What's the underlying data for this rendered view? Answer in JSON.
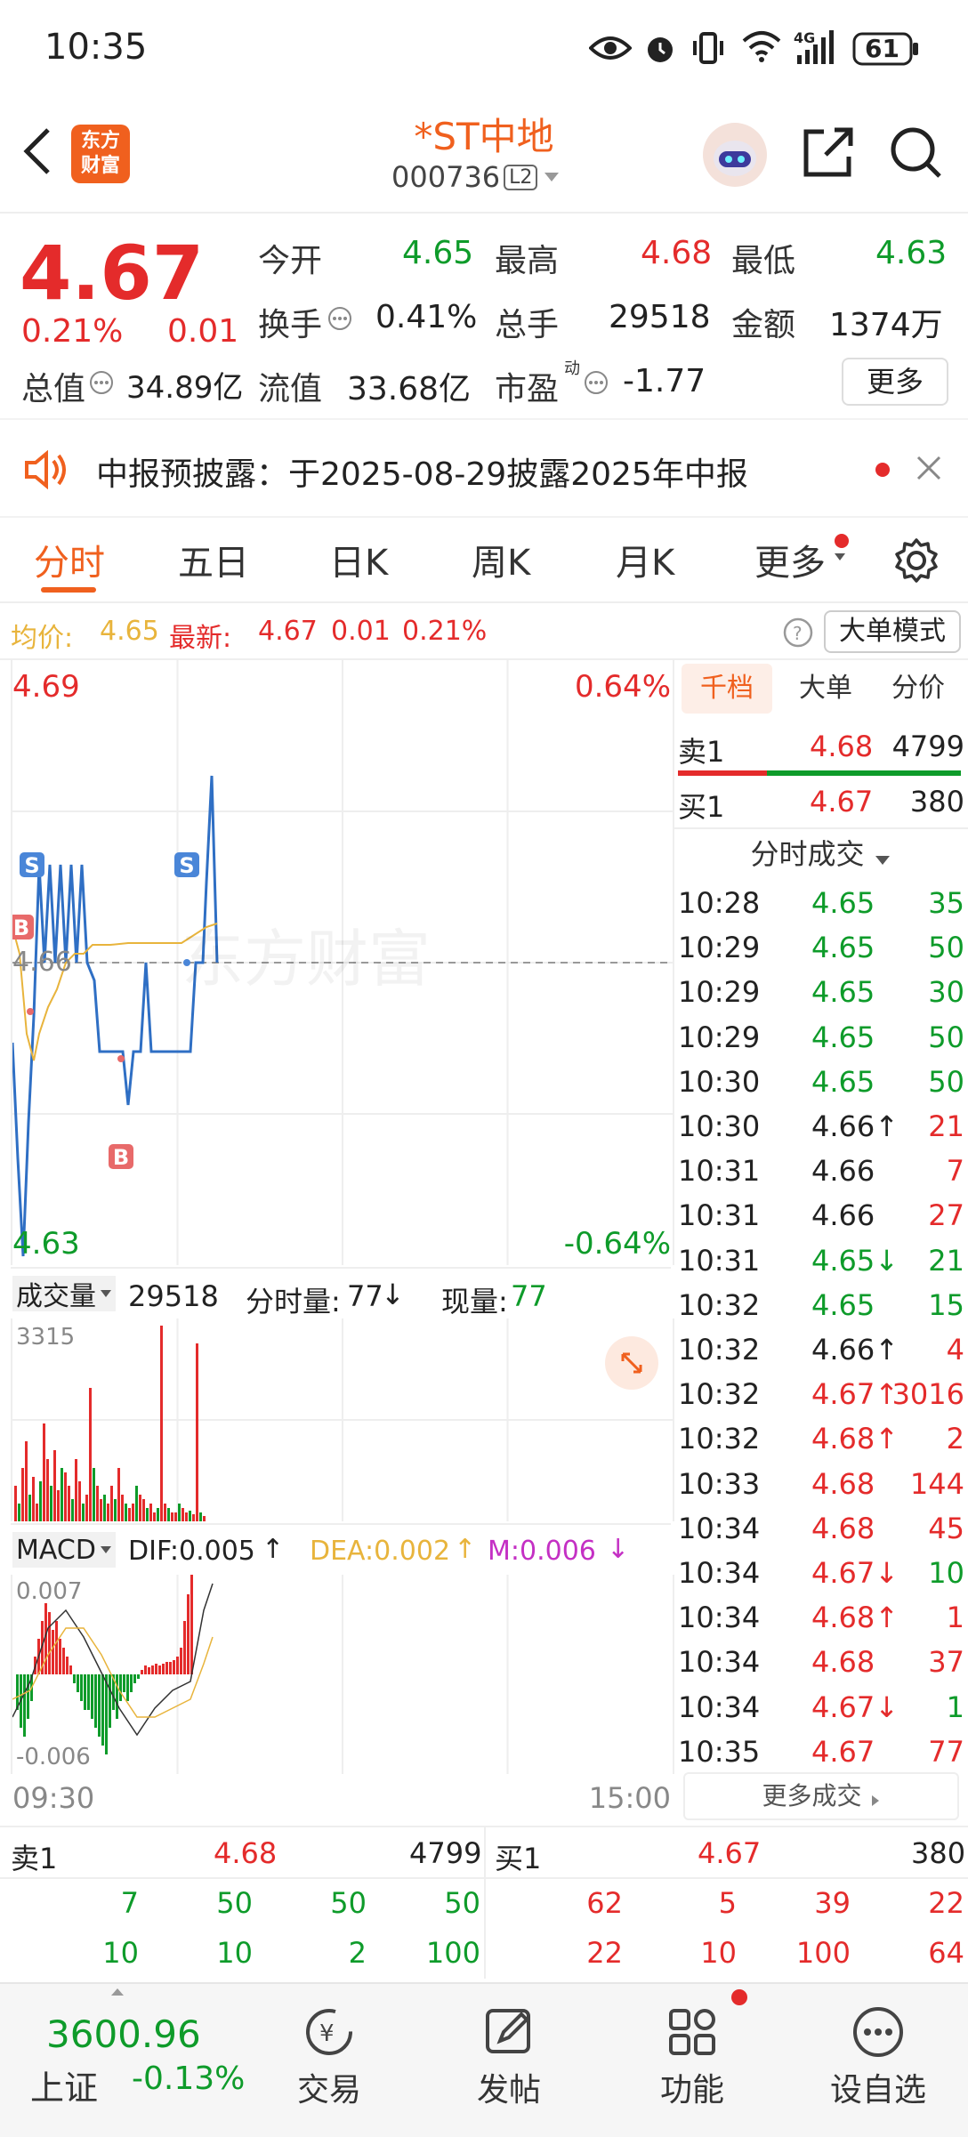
{
  "status_bar": {
    "time": "10:35",
    "battery": "61"
  },
  "header": {
    "logo_text_top": "东方",
    "logo_text_bottom": "财富",
    "stock_name": "*ST中地",
    "stock_code": "000736",
    "level_badge": "L2"
  },
  "quote": {
    "price": "4.67",
    "change_pct": "0.21%",
    "change_abs": "0.01",
    "open_label": "今开",
    "open_value": "4.65",
    "high_label": "最高",
    "high_value": "4.68",
    "low_label": "最低",
    "low_value": "4.63",
    "turnover_label": "换手",
    "turnover_value": "0.41%",
    "volume_label": "总手",
    "volume_value": "29518",
    "amount_label": "金额",
    "amount_value": "1374万",
    "mktcap_label": "总值",
    "mktcap_value": "34.89亿",
    "float_label": "流值",
    "float_value": "33.68亿",
    "pe_label": "市盈",
    "pe_sup": "动",
    "pe_value": "-1.77",
    "more_button": "更多"
  },
  "notice": {
    "text": "中报预披露：于2025-08-29披露2025年中报"
  },
  "tabs": [
    "分时",
    "五日",
    "日K",
    "周K",
    "月K",
    "更多"
  ],
  "info_line": {
    "avg_label": "均价:",
    "avg_value": "4.65",
    "latest_label": "最新:",
    "latest_value": "4.67",
    "change": "0.01",
    "change_pct": "0.21%",
    "mode_button": "大单模式"
  },
  "price_chart": {
    "y_top": "4.69",
    "y_bottom": "4.63",
    "y_mid": "4.66",
    "pct_top": "0.64%",
    "pct_bottom": "-0.64%",
    "watermark": "东方财富",
    "time_start": "09:30",
    "time_end": "15:00"
  },
  "volume_panel": {
    "selector": "成交量",
    "total": "29518",
    "fs_label": "分时量:",
    "fs_value": "77",
    "fs_arrow": "↓",
    "current_label": "现量:",
    "current_value": "77",
    "max_label": "3315"
  },
  "macd_panel": {
    "selector": "MACD",
    "dif": "DIF:0.005",
    "dif_arrow": "↑",
    "dea": "DEA:0.002",
    "dea_arrow": "↑",
    "m": "M:0.006",
    "m_arrow": "↓",
    "top_label": "0.007",
    "bottom_label": "-0.006"
  },
  "side_panel": {
    "tabs": [
      "千档",
      "大单",
      "分价"
    ],
    "sell1_label": "卖1",
    "sell1_price": "4.68",
    "sell1_vol": "4799",
    "buy1_label": "买1",
    "buy1_price": "4.67",
    "buy1_vol": "380",
    "trades_title": "分时成交",
    "trades": [
      {
        "t": "10:28",
        "p": "4.65",
        "arrow": "",
        "v": "35",
        "pc": "green",
        "vc": "green"
      },
      {
        "t": "10:29",
        "p": "4.65",
        "arrow": "",
        "v": "50",
        "pc": "green",
        "vc": "green"
      },
      {
        "t": "10:29",
        "p": "4.65",
        "arrow": "",
        "v": "30",
        "pc": "green",
        "vc": "green"
      },
      {
        "t": "10:29",
        "p": "4.65",
        "arrow": "",
        "v": "50",
        "pc": "green",
        "vc": "green"
      },
      {
        "t": "10:30",
        "p": "4.65",
        "arrow": "",
        "v": "50",
        "pc": "green",
        "vc": "green"
      },
      {
        "t": "10:30",
        "p": "4.66",
        "arrow": "↑",
        "v": "21",
        "pc": "black",
        "vc": "red"
      },
      {
        "t": "10:31",
        "p": "4.66",
        "arrow": "",
        "v": "7",
        "pc": "black",
        "vc": "red"
      },
      {
        "t": "10:31",
        "p": "4.66",
        "arrow": "",
        "v": "27",
        "pc": "black",
        "vc": "red"
      },
      {
        "t": "10:31",
        "p": "4.65",
        "arrow": "↓",
        "v": "21",
        "pc": "green",
        "vc": "green"
      },
      {
        "t": "10:32",
        "p": "4.65",
        "arrow": "",
        "v": "15",
        "pc": "green",
        "vc": "green"
      },
      {
        "t": "10:32",
        "p": "4.66",
        "arrow": "↑",
        "v": "4",
        "pc": "black",
        "vc": "red"
      },
      {
        "t": "10:32",
        "p": "4.67",
        "arrow": "↑",
        "v": "3016",
        "pc": "red",
        "vc": "red"
      },
      {
        "t": "10:32",
        "p": "4.68",
        "arrow": "↑",
        "v": "2",
        "pc": "red",
        "vc": "red"
      },
      {
        "t": "10:33",
        "p": "4.68",
        "arrow": "",
        "v": "144",
        "pc": "red",
        "vc": "red"
      },
      {
        "t": "10:34",
        "p": "4.68",
        "arrow": "",
        "v": "45",
        "pc": "red",
        "vc": "red"
      },
      {
        "t": "10:34",
        "p": "4.67",
        "arrow": "↓",
        "v": "10",
        "pc": "red",
        "vc": "green"
      },
      {
        "t": "10:34",
        "p": "4.68",
        "arrow": "↑",
        "v": "1",
        "pc": "red",
        "vc": "red"
      },
      {
        "t": "10:34",
        "p": "4.68",
        "arrow": "",
        "v": "37",
        "pc": "red",
        "vc": "red"
      },
      {
        "t": "10:34",
        "p": "4.67",
        "arrow": "↓",
        "v": "1",
        "pc": "red",
        "vc": "green"
      },
      {
        "t": "10:35",
        "p": "4.67",
        "arrow": "",
        "v": "77",
        "pc": "red",
        "vc": "red"
      }
    ],
    "more_trades": "更多成交"
  },
  "order_book": {
    "sell_label": "卖1",
    "sell_price": "4.68",
    "sell_vol": "4799",
    "buy_label": "买1",
    "buy_price": "4.67",
    "buy_vol": "380",
    "sell_queue_row1": [
      "7",
      "50",
      "50",
      "50"
    ],
    "sell_queue_row2": [
      "10",
      "10",
      "2",
      "100"
    ],
    "buy_queue_row1": [
      "62",
      "5",
      "39",
      "22"
    ],
    "buy_queue_row2": [
      "22",
      "10",
      "100",
      "64"
    ]
  },
  "bottom_nav": {
    "index_value": "3600.96",
    "index_name": "上证",
    "index_change": "-0.13%",
    "items": [
      "交易",
      "发帖",
      "功能",
      "设自选"
    ]
  },
  "colors": {
    "up": "#e42b2b",
    "down": "#0e9b2a",
    "accent": "#f0601e",
    "line": "#2f6fc4",
    "avg": "#e8b43c"
  }
}
